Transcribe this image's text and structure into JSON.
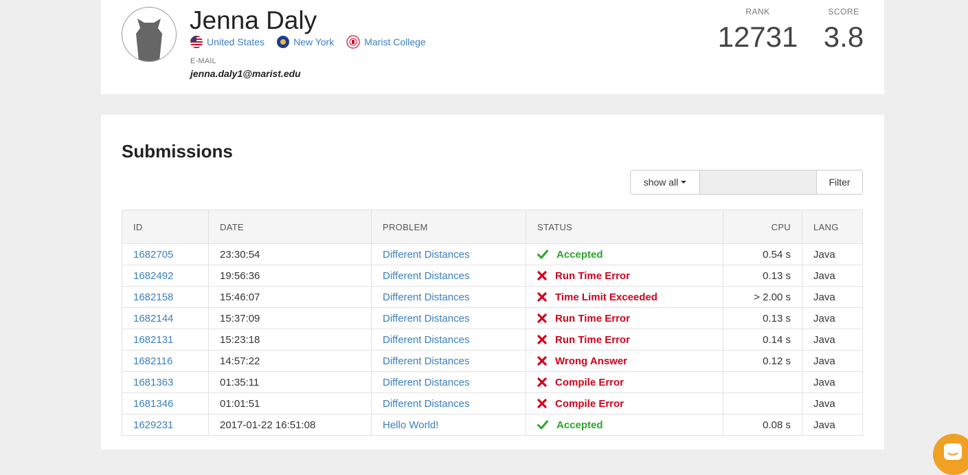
{
  "profile": {
    "name": "Jenna Daly",
    "locations": [
      {
        "label": "United States",
        "icon": "us-flag-icon"
      },
      {
        "label": "New York",
        "icon": "new-york-flag-icon"
      },
      {
        "label": "Marist College",
        "icon": "marist-college-seal-icon"
      }
    ],
    "email_label": "E-MAIL",
    "email": "jenna.daly1@marist.edu",
    "rank_label": "RANK",
    "rank": "12731",
    "score_label": "SCORE",
    "score": "3.8"
  },
  "submissions": {
    "title": "Submissions",
    "filter": {
      "show_label": "show all",
      "input_value": "",
      "button_label": "Filter"
    },
    "columns": {
      "id": "ID",
      "date": "DATE",
      "problem": "PROBLEM",
      "status": "STATUS",
      "cpu": "CPU",
      "lang": "LANG"
    },
    "rows": [
      {
        "id": "1682705",
        "date": "23:30:54",
        "problem": "Different Distances",
        "status": "Accepted",
        "ok": true,
        "cpu": "0.54 s",
        "lang": "Java"
      },
      {
        "id": "1682492",
        "date": "19:56:36",
        "problem": "Different Distances",
        "status": "Run Time Error",
        "ok": false,
        "cpu": "0.13 s",
        "lang": "Java"
      },
      {
        "id": "1682158",
        "date": "15:46:07",
        "problem": "Different Distances",
        "status": "Time Limit Exceeded",
        "ok": false,
        "cpu": "> 2.00 s",
        "lang": "Java"
      },
      {
        "id": "1682144",
        "date": "15:37:09",
        "problem": "Different Distances",
        "status": "Run Time Error",
        "ok": false,
        "cpu": "0.13 s",
        "lang": "Java"
      },
      {
        "id": "1682131",
        "date": "15:23:18",
        "problem": "Different Distances",
        "status": "Run Time Error",
        "ok": false,
        "cpu": "0.14 s",
        "lang": "Java"
      },
      {
        "id": "1682116",
        "date": "14:57:22",
        "problem": "Different Distances",
        "status": "Wrong Answer",
        "ok": false,
        "cpu": "0.12 s",
        "lang": "Java"
      },
      {
        "id": "1681363",
        "date": "01:35:11",
        "problem": "Different Distances",
        "status": "Compile Error",
        "ok": false,
        "cpu": "",
        "lang": "Java"
      },
      {
        "id": "1681346",
        "date": "01:01:51",
        "problem": "Different Distances",
        "status": "Compile Error",
        "ok": false,
        "cpu": "",
        "lang": "Java"
      },
      {
        "id": "1629231",
        "date": "2017-01-22 16:51:08",
        "problem": "Hello World!",
        "status": "Accepted",
        "ok": true,
        "cpu": "0.08 s",
        "lang": "Java"
      }
    ]
  },
  "colors": {
    "link": "#3a7fc1",
    "accepted": "#2aa52a",
    "error": "#d0021b",
    "chat": "#f0a023"
  },
  "chat_widget": {
    "icon": "chat-icon"
  }
}
